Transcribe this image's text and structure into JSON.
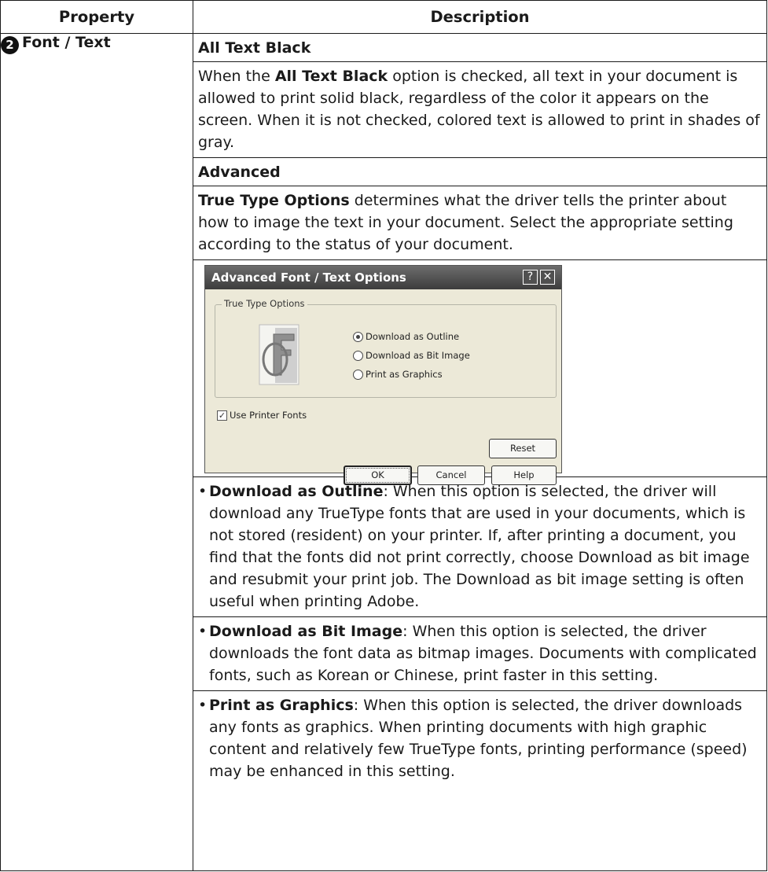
{
  "header": {
    "property": "Property",
    "description": "Description"
  },
  "row": {
    "badge": "2",
    "property_label": "Font / Text",
    "all_text_black": {
      "heading": "All Text Black",
      "p_before": "When the ",
      "p_bold": "All Text Black",
      "p_after": " option is checked, all text in your document is allowed to print solid black, regardless of the color it appears on the screen. When it is not checked, colored text is allowed to print in shades of gray."
    },
    "advanced": {
      "heading": "Advanced",
      "p_bold": "True Type Options",
      "p_after": " determines what the driver tells the printer about how to image the text in your document. Select the appropriate setting according to the status of your document."
    },
    "dialog": {
      "title": "Advanced Font / Text Options",
      "help_glyph": "?",
      "close_glyph": "✕",
      "group_label": "True Type Options",
      "options": [
        "Download as Outline",
        "Download as Bit Image",
        "Print as Graphics"
      ],
      "selected_option": "Download as Outline",
      "checkbox_label": "Use Printer Fonts",
      "checkbox_checked": true,
      "reset_label": "Reset",
      "ok_label": "OK",
      "cancel_label": "Cancel",
      "help_label": "Help"
    },
    "bullets": [
      {
        "term": "Download as Outline",
        "text": ": When this option is selected, the driver will download any TrueType fonts that are used in your documents, which is not stored (resident) on your printer. If, after printing a document, you find that the fonts did not print correctly, choose Download as bit image and resubmit your print job. The Download as bit image setting is often useful when printing Adobe."
      },
      {
        "term": "Download as Bit Image",
        "text": ": When this option is selected, the driver downloads the font data as bitmap images. Documents with complicated fonts, such as Korean or Chinese, print faster in this setting."
      },
      {
        "term": "Print as Graphics",
        "text": ": When this option is selected, the driver downloads any fonts as graphics. When printing documents with high graphic content and relatively few TrueType fonts, printing performance (speed) may be enhanced in this setting."
      }
    ]
  }
}
